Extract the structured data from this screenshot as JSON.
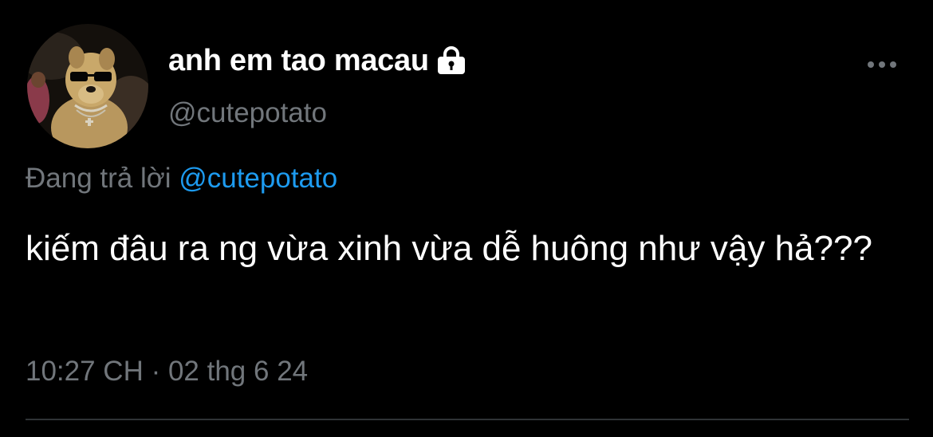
{
  "author": {
    "display_name": "anh em tao macau",
    "handle": "@cutepotato",
    "avatar_icon": "dog-with-sunglasses-avatar",
    "protected_icon": "lock-icon"
  },
  "more_icon": "more-horizontal-icon",
  "reply": {
    "prefix": "Đang trả lời ",
    "mention": "@cutepotato"
  },
  "tweet": {
    "text": "kiếm đâu ra ng vừa xinh vừa dễ huông như vậy hả???",
    "timestamp": "10:27 CH · 02 thg 6 24"
  },
  "colors": {
    "background": "#000000",
    "primary_text": "#ffffff",
    "secondary_text": "#71767b",
    "accent": "#1d9bf0",
    "divider": "#2f3336"
  }
}
